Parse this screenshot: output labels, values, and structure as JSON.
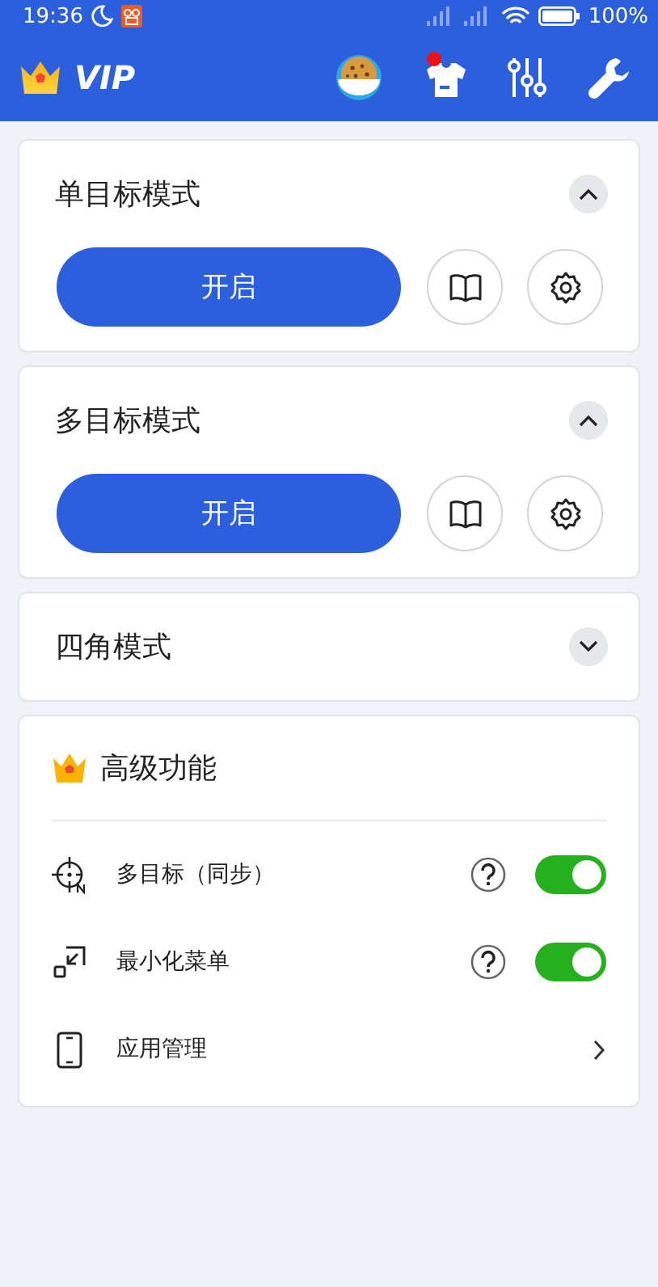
{
  "status_bar": {
    "time": "19:36",
    "battery_text": "100%"
  },
  "header": {
    "logo_text": "VIP",
    "shirt_badge": true
  },
  "modes": [
    {
      "title": "单目标模式",
      "expanded": true,
      "button": "开启"
    },
    {
      "title": "多目标模式",
      "expanded": true,
      "button": "开启"
    },
    {
      "title": "四角模式",
      "expanded": false
    }
  ],
  "advanced": {
    "title": "高级功能",
    "items": [
      {
        "kind": "toggle",
        "label": "多目标（同步）",
        "on": true
      },
      {
        "kind": "toggle",
        "label": "最小化菜单",
        "on": true
      },
      {
        "kind": "link",
        "label": "应用管理"
      }
    ]
  }
}
